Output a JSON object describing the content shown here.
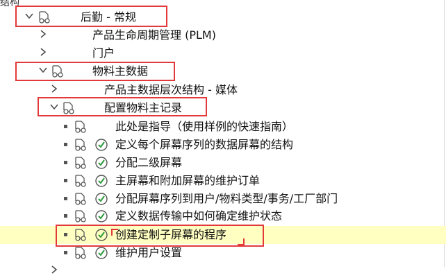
{
  "header": {
    "title": "结构"
  },
  "tree": [
    {
      "label": "后勤 - 常规"
    },
    {
      "label": "产品生命周期管理 (PLM)"
    },
    {
      "label": "门户"
    },
    {
      "label": "物料主数据"
    },
    {
      "label": "产品主数据层次结构 - 媒体"
    },
    {
      "label": "配置物料主记录"
    },
    {
      "label": "此处是指导（使用样例的快速指南）"
    },
    {
      "label": "定义每个屏幕序列的数据屏幕的结构"
    },
    {
      "label": "分配二级屏幕"
    },
    {
      "label": "主屏幕和附加屏幕的维护订单"
    },
    {
      "label": "分配屏幕序列到用户/物料类型/事务/工厂部门"
    },
    {
      "label": "定义数据传输中如何确定维护状态"
    },
    {
      "label": "创建定制子屏幕的程序"
    },
    {
      "label": "维护用户设置"
    }
  ],
  "colors": {
    "highlight": "#ffffc2",
    "annotation_red": "#e23a3a",
    "check_green": "#2a9a3a"
  }
}
